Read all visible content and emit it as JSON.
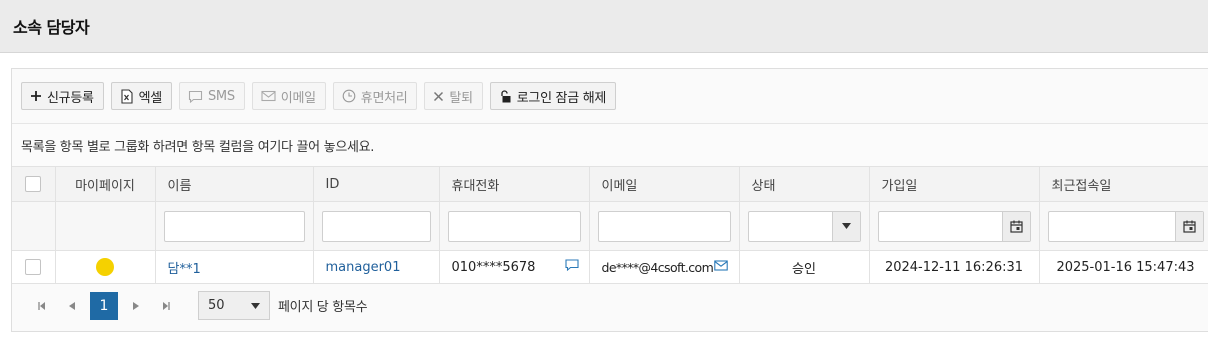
{
  "header": {
    "title": "소속 담당자"
  },
  "toolbar": {
    "new_label": "신규등록",
    "excel_label": "엑셀",
    "sms_label": "SMS",
    "email_label": "이메일",
    "dormant_label": "휴면처리",
    "withdraw_label": "탈퇴",
    "unlock_label": "로그인 잠금 해제"
  },
  "grid": {
    "group_hint": "목록을 항목 별로 그룹화 하려면 항목 컬럼을 여기다 끌어 놓으세요.",
    "columns": {
      "mypage": "마이페이지",
      "name": "이름",
      "id": "ID",
      "phone": "휴대전화",
      "email": "이메일",
      "status": "상태",
      "joined": "가입일",
      "last_login": "최근접속일"
    },
    "rows": [
      {
        "name": "담**1",
        "id": "manager01",
        "phone": "010****5678",
        "email": "de****@4csoft.com",
        "status": "승인",
        "joined": "2024-12-11 16:26:31",
        "last_login": "2025-01-16 15:47:43",
        "mypage_color": "#f5d100"
      }
    ]
  },
  "pager": {
    "current_page": "1",
    "page_size": "50",
    "page_size_label": "페이지 당 항목수"
  }
}
